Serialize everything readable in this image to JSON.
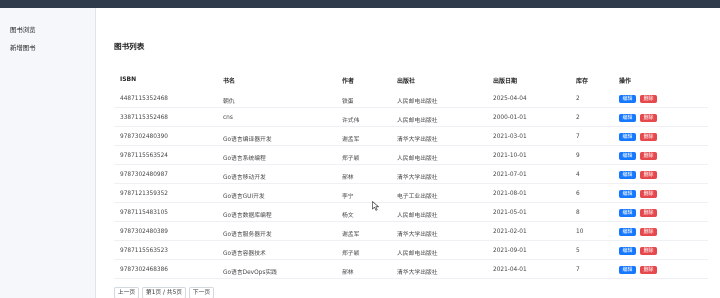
{
  "sidebar": {
    "items": [
      {
        "label": "图书浏览"
      },
      {
        "label": "新增图书"
      }
    ]
  },
  "main": {
    "title": "图书列表"
  },
  "table": {
    "headers": {
      "isbn": "ISBN",
      "title": "书名",
      "author": "作者",
      "publisher": "出版社",
      "date": "出版日期",
      "stock": "库存",
      "actions": "操作"
    },
    "rows": [
      {
        "isbn": "4487115352468",
        "title": "朝仇",
        "author": "铁蛋",
        "publisher": "人民邮电出版社",
        "date": "2025-04-04",
        "stock": "2"
      },
      {
        "isbn": "3387115352468",
        "title": "cns",
        "author": "许式伟",
        "publisher": "人民邮电出版社",
        "date": "2000-01-01",
        "stock": "2"
      },
      {
        "isbn": "9787302480390",
        "title": "Go语言编译器开发",
        "author": "谢孟军",
        "publisher": "清华大学出版社",
        "date": "2021-03-01",
        "stock": "7"
      },
      {
        "isbn": "9787115563524",
        "title": "Go语言系统编程",
        "author": "郑子颖",
        "publisher": "人民邮电出版社",
        "date": "2021-10-01",
        "stock": "9"
      },
      {
        "isbn": "9787302480987",
        "title": "Go语言移动开发",
        "author": "郝林",
        "publisher": "清华大学出版社",
        "date": "2021-07-01",
        "stock": "4"
      },
      {
        "isbn": "9787121359352",
        "title": "Go语言GUI开发",
        "author": "李宁",
        "publisher": "电子工业出版社",
        "date": "2021-08-01",
        "stock": "6"
      },
      {
        "isbn": "9787115483105",
        "title": "Go语言数据库编程",
        "author": "杨文",
        "publisher": "人民邮电出版社",
        "date": "2021-05-01",
        "stock": "8"
      },
      {
        "isbn": "9787302480389",
        "title": "Go语言服务器开发",
        "author": "谢孟军",
        "publisher": "清华大学出版社",
        "date": "2021-02-01",
        "stock": "10"
      },
      {
        "isbn": "9787115563523",
        "title": "Go语言容器技术",
        "author": "郑子颖",
        "publisher": "人民邮电出版社",
        "date": "2021-09-01",
        "stock": "5"
      },
      {
        "isbn": "9787302468386",
        "title": "Go语言DevOps实践",
        "author": "郝林",
        "publisher": "清华大学出版社",
        "date": "2021-04-01",
        "stock": "7"
      }
    ],
    "edit_label": "编辑",
    "delete_label": "删除"
  },
  "pagination": {
    "prev_label": "上一页",
    "page_info": "第1页 / 共5页",
    "next_label": "下一页"
  },
  "colors": {
    "edit": "#1677ff",
    "delete": "#e5484d",
    "topbar": "#2f3a4a"
  }
}
